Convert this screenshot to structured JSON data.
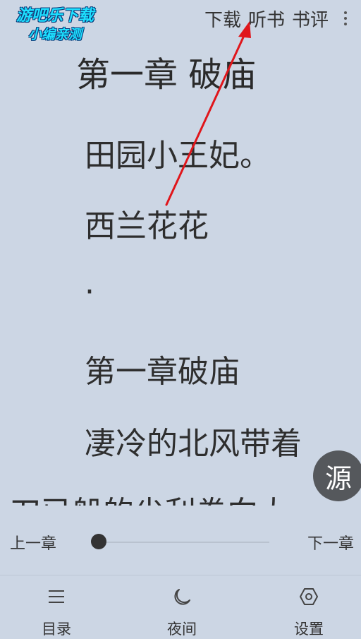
{
  "watermark": {
    "line1": "游吧乐下载",
    "line2": "小编亲测"
  },
  "top_bar": {
    "actions": [
      {
        "id": "download",
        "label": "下载"
      },
      {
        "id": "listen",
        "label": "听书"
      },
      {
        "id": "review",
        "label": "书评"
      }
    ],
    "more_icon": "more-vertical-icon"
  },
  "reader": {
    "chapter_title": "第一章 破庙",
    "paragraphs": [
      "田园小王妃。",
      "西兰花花",
      "·",
      "第一章破庙",
      "凄冷的北风带着",
      "刀已船的尖利卷向大"
    ]
  },
  "source_button": {
    "label": "源"
  },
  "chapter_nav": {
    "prev": "上一章",
    "next": "下一章",
    "progress": 0
  },
  "bottom_tabs": [
    {
      "id": "toc",
      "label": "目录",
      "icon": "menu-icon"
    },
    {
      "id": "night",
      "label": "夜间",
      "icon": "moon-icon"
    },
    {
      "id": "settings",
      "label": "设置",
      "icon": "hexagon-settings-icon"
    }
  ],
  "colors": {
    "background": "#ccd6e4",
    "text": "#2c2c2c",
    "annotation_arrow": "#e0161b",
    "source_button": "#55585c",
    "watermark": "#1ee0ff"
  }
}
